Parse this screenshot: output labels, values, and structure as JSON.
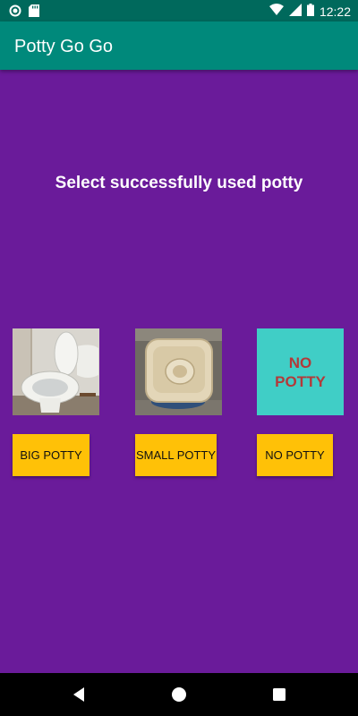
{
  "status_bar": {
    "time": "12:22",
    "icons": [
      "circle-notification-icon",
      "sd-card-icon",
      "wifi-icon",
      "signal-icon",
      "battery-icon"
    ]
  },
  "app_bar": {
    "title": "Potty Go Go"
  },
  "main": {
    "prompt": "Select successfully used potty",
    "choices": [
      {
        "image": "toilet-image",
        "button_label": "BIG POTTY"
      },
      {
        "image": "potty-chair-image",
        "button_label": "SMALL POTTY"
      },
      {
        "image_text": "NO\nPOTTY",
        "button_label": "NO POTTY"
      }
    ]
  },
  "nav_bar": {
    "icons": [
      "back-icon",
      "home-icon",
      "recents-icon"
    ]
  },
  "colors": {
    "status_bar": "#00695c",
    "app_bar": "#00897b",
    "background": "#6a1b9a",
    "button": "#ffc107",
    "no_potty_tile": "#40cec6",
    "no_potty_text": "#b23a3a"
  }
}
